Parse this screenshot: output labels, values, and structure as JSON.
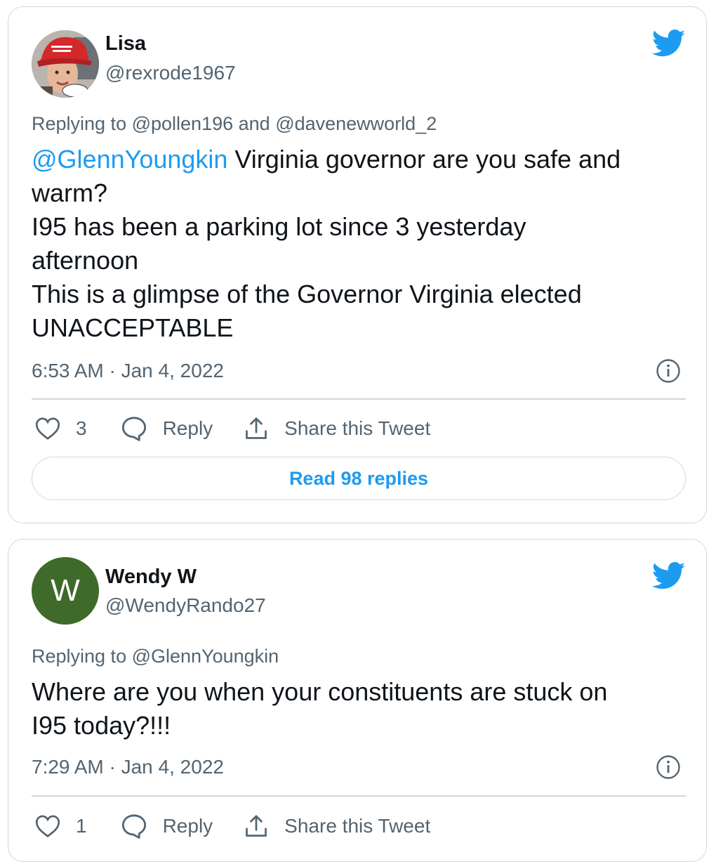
{
  "tweets": [
    {
      "name": "Lisa",
      "handle": "@rexrode1967",
      "replying_prefix": "Replying to ",
      "replying_to": [
        "@pollen196",
        "@davenewworld_2"
      ],
      "replying_joiner": " and ",
      "body_mention": "@GlennYoungkin",
      "body_lines": [
        " Virginia governor are you safe and",
        "warm?",
        "I95 has been a parking lot since 3 yesterday",
        "afternoon",
        "This is a glimpse of the Governor Virginia elected",
        "UNACCEPTABLE"
      ],
      "timestamp": "6:53 AM · Jan 4, 2022",
      "likes": "3",
      "reply_label": "Reply",
      "share_label": "Share this Tweet",
      "read_replies_label": "Read 98 replies"
    },
    {
      "name": "Wendy W",
      "handle": "@WendyRando27",
      "avatar_letter": "W",
      "replying_prefix": "Replying to ",
      "replying_to": [
        "@GlennYoungkin"
      ],
      "body_lines": [
        "Where are you when your constituents are stuck on",
        "I95 today?!!!"
      ],
      "timestamp": "7:29 AM · Jan 4, 2022",
      "likes": "1",
      "reply_label": "Reply",
      "share_label": "Share this Tweet"
    }
  ],
  "colors": {
    "accent": "#1d9bf0",
    "muted": "#536471",
    "border": "#cfd9de",
    "avatar_bg": "#3e6a2a"
  },
  "icons": [
    "twitter-bird-icon",
    "info-icon",
    "heart-icon",
    "reply-bubble-icon",
    "share-icon"
  ]
}
